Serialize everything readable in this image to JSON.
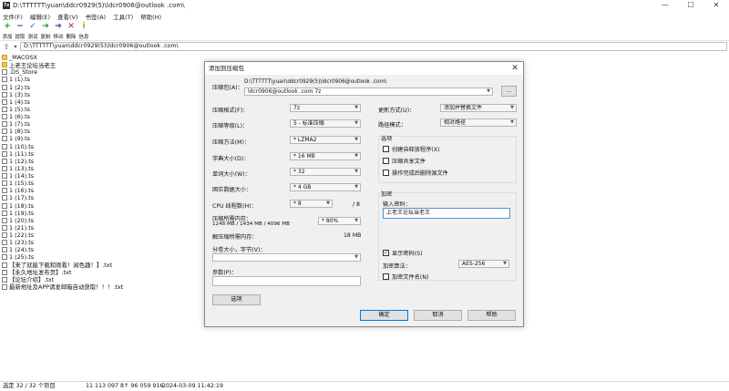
{
  "window": {
    "app_icon_text": "7z",
    "title": "D:\\TTTTTT\\yuan\\ddcr0929(5)\\ldcr0906@outlook .com\\",
    "controls": [
      "—",
      "☐",
      "✕"
    ]
  },
  "menu": [
    "文件(F)",
    "编辑(E)",
    "查看(V)",
    "书签(A)",
    "工具(T)",
    "帮助(H)"
  ],
  "toolbar": {
    "add": "添加",
    "extract": "提取",
    "test": "测试",
    "copy": "复制",
    "move": "移动",
    "delete": "删除",
    "info": "信息"
  },
  "address": {
    "path": "D:\\TTTTTT\\yuan\\ddcr0929(5)\\ldcr0906@outlook .com\\"
  },
  "files": [
    {
      "name": "_MACOSX",
      "type": "folder"
    },
    {
      "name": "上老王论坛当老王",
      "type": "folder"
    },
    {
      "name": ".DS_Store",
      "type": "file"
    },
    {
      "name": "1 (1).ts",
      "type": "file"
    },
    {
      "name": "1 (2).ts",
      "type": "file"
    },
    {
      "name": "1 (3).ts",
      "type": "file"
    },
    {
      "name": "1 (4).ts",
      "type": "file"
    },
    {
      "name": "1 (5).ts",
      "type": "file"
    },
    {
      "name": "1 (6).ts",
      "type": "file"
    },
    {
      "name": "1 (7).ts",
      "type": "file"
    },
    {
      "name": "1 (8).ts",
      "type": "file"
    },
    {
      "name": "1 (9).ts",
      "type": "file"
    },
    {
      "name": "1 (10).ts",
      "type": "file"
    },
    {
      "name": "1 (11).ts",
      "type": "file"
    },
    {
      "name": "1 (12).ts",
      "type": "file"
    },
    {
      "name": "1 (13).ts",
      "type": "file"
    },
    {
      "name": "1 (14).ts",
      "type": "file"
    },
    {
      "name": "1 (15).ts",
      "type": "file"
    },
    {
      "name": "1 (16).ts",
      "type": "file"
    },
    {
      "name": "1 (17).ts",
      "type": "file"
    },
    {
      "name": "1 (18).ts",
      "type": "file"
    },
    {
      "name": "1 (19).ts",
      "type": "file"
    },
    {
      "name": "1 (20).ts",
      "type": "file"
    },
    {
      "name": "1 (21).ts",
      "type": "file"
    },
    {
      "name": "1 (22).ts",
      "type": "file"
    },
    {
      "name": "1 (23).ts",
      "type": "file"
    },
    {
      "name": "1 (24).ts",
      "type": "file"
    },
    {
      "name": "1 (25).ts",
      "type": "file"
    },
    {
      "name": "【来了就能下载和观看！阅色趣！】.txt",
      "type": "file"
    },
    {
      "name": "【永久地址发布页】.txt",
      "type": "file"
    },
    {
      "name": "【论坛介绍】.txt",
      "type": "file"
    },
    {
      "name": "最新地址及APP请发邮箱自动获取！！！.txt",
      "type": "file"
    }
  ],
  "status": {
    "selection": "选定 32 / 32 个项目",
    "sizes": "11 113 097 8↑ 96 059 916",
    "datetime": "2024-03-09 11:42:19"
  },
  "dialog": {
    "title": "添加到压缩包",
    "close": "✕",
    "archive_label": "压缩包(A)：",
    "archive_dir": "D:\\TTTTTT\\yuan\\ddcr0929(5)\\ldcr0906@outlook .com\\",
    "archive_name": "ldcr0906@outlook .com 7z",
    "browse": "...",
    "format_label": "压缩格式(F)：",
    "format_value": "7z",
    "level_label": "压缩等级(L)：",
    "level_value": "5 - 标准压缩",
    "method_label": "压缩方法(M)：",
    "method_value": "* LZMA2",
    "dict_label": "字典大小(D)：",
    "dict_value": "* 16 MB",
    "word_label": "单词大小(W)：",
    "word_value": "* 32",
    "solid_label": "固实数据大小：",
    "solid_value": "* 4 GB",
    "threads_label": "CPU 线程数(H)：",
    "threads_value": "* 8",
    "threads_max": "/ 8",
    "mem_label": "压缩所需内存：",
    "mem_detail": "1248 MB / 1434 MB / 4096 MB",
    "mem_value": "* 80%",
    "decomp_label": "解压缩所需内存：",
    "decomp_value": "18 MB",
    "split_label": "分卷大小，字节(V)：",
    "params_label": "参数(P)：",
    "options_button": "选项",
    "update_label": "更新方式(U)：",
    "update_value": "添加并替换文件",
    "path_label": "路径模式：",
    "path_value": "相对路径",
    "options_group": "选项",
    "opt_sfx": "创建自释放程序(X)",
    "opt_shared": "压缩共享文件",
    "opt_delete": "操作完成后删除源文件",
    "encrypt_group": "加密",
    "pwd_label": "输入密码：",
    "pwd_value": "上老王论坛当老王",
    "show_pwd": "显示密码(S)",
    "enc_method_label": "加密算法：",
    "enc_method_value": "AES-256",
    "enc_names": "加密文件名(N)",
    "ok": "确定",
    "cancel": "取消",
    "help": "帮助"
  }
}
